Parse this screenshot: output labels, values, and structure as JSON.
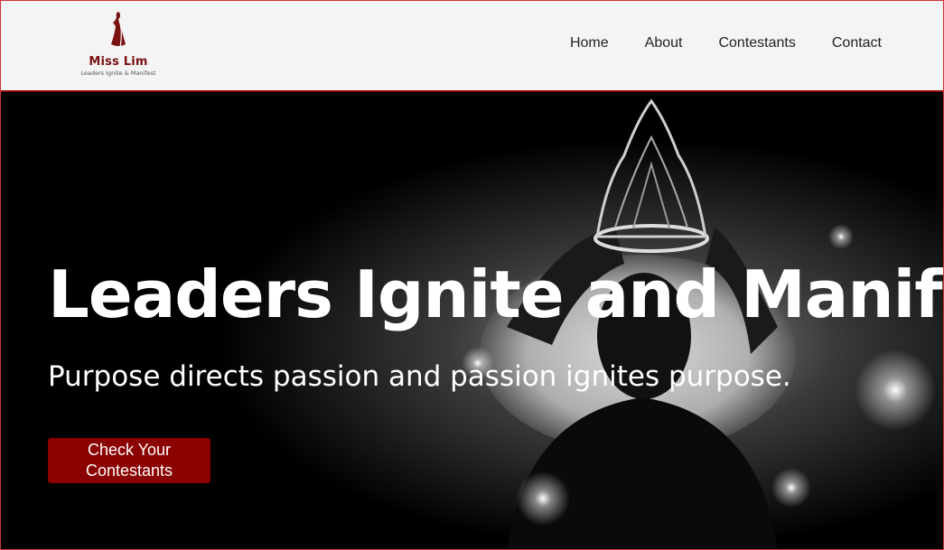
{
  "brand": {
    "name": "Miss Lim",
    "tagline": "Leaders Ignite & Manifest",
    "accent_color": "#8b0000",
    "icon": "woman-silhouette-logo-icon"
  },
  "nav": {
    "items": [
      {
        "label": "Home"
      },
      {
        "label": "About"
      },
      {
        "label": "Contestants"
      },
      {
        "label": "Contact"
      }
    ]
  },
  "hero": {
    "title": "Leaders Ignite and Manifest",
    "subtitle": "Purpose directs passion and passion ignites purpose.",
    "cta_label": "Check Your Contestants",
    "background_image": "black-and-white-woman-placing-crown-on-head"
  }
}
